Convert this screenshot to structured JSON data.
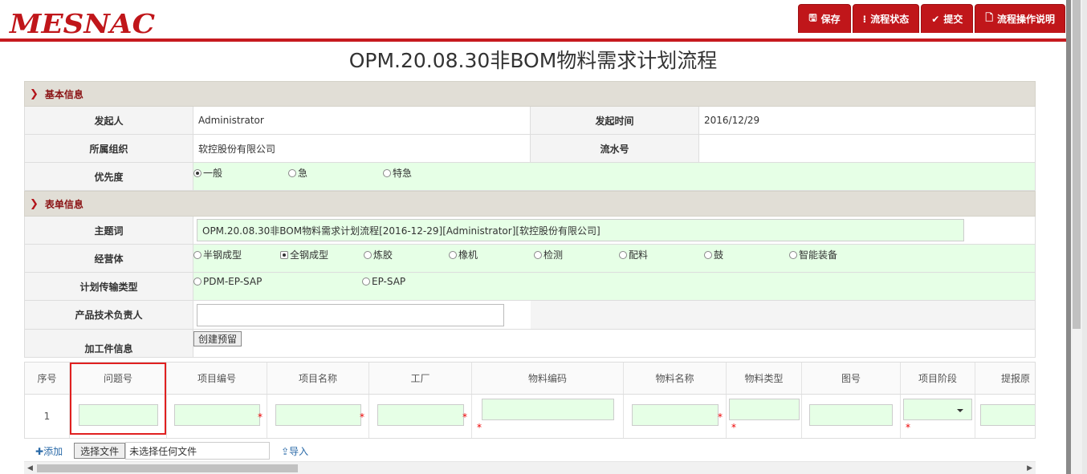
{
  "header": {
    "logo": "MESNAC",
    "buttons": [
      {
        "icon": "save-icon",
        "glyph": "🖫",
        "label": "保存"
      },
      {
        "icon": "status-icon",
        "glyph": "⁝",
        "label": "流程状态"
      },
      {
        "icon": "check-icon",
        "glyph": "✔",
        "label": "提交"
      },
      {
        "icon": "doc-icon",
        "glyph": "🗋",
        "label": "流程操作说明"
      }
    ]
  },
  "page_title": "OPM.20.08.30非BOM物料需求计划流程",
  "basic": {
    "section_title": "基本信息",
    "initiator_label": "发起人",
    "initiator_value": "Administrator",
    "time_label": "发起时间",
    "time_value": "2016/12/29",
    "org_label": "所属组织",
    "org_value": "软控股份有限公司",
    "serial_label": "流水号",
    "serial_value": "",
    "priority_label": "优先度",
    "priority_options": [
      "一般",
      "急",
      "特急"
    ],
    "priority_selected": 0
  },
  "form": {
    "section_title": "表单信息",
    "subject_label": "主题词",
    "subject_value": "OPM.20.08.30非BOM物料需求计划流程[2016-12-29][Administrator][软控股份有限公司]",
    "biz_label": "经营体",
    "biz_options": [
      "半钢成型",
      "全钢成型",
      "炼胶",
      "橡机",
      "检测",
      "配料",
      "鼓",
      "智能装备"
    ],
    "biz_selected": 1,
    "transfer_label": "计划传输类型",
    "transfer_options": [
      "PDM-EP-SAP",
      "EP-SAP"
    ],
    "owner_label": "产品技术负责人",
    "owner_value": "",
    "process_label": "加工件信息",
    "create_btn": "创建预留"
  },
  "grid": {
    "columns": [
      "序号",
      "问题号",
      "项目编号",
      "项目名称",
      "工厂",
      "物料编码",
      "物料名称",
      "物料类型",
      "图号",
      "项目阶段",
      "提报原"
    ],
    "row_no": "1"
  },
  "footer": {
    "add": "添加",
    "file_btn": "选择文件",
    "file_status": "未选择任何文件",
    "import": "导入"
  },
  "colors": {
    "brand": "#c0161a",
    "section_bg": "#e1ded6",
    "input_green": "#e6ffe6"
  }
}
